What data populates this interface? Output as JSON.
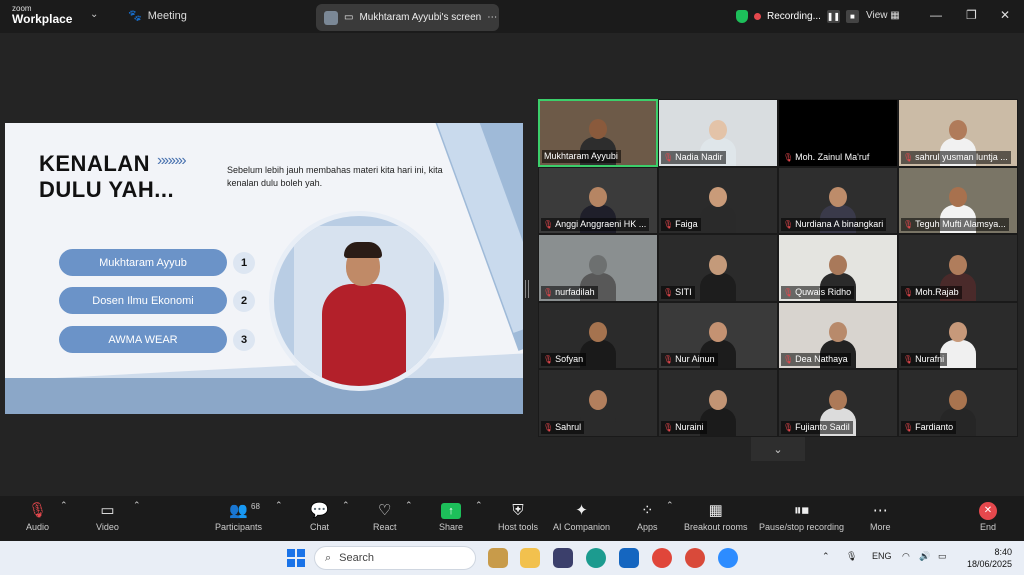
{
  "titlebar": {
    "brand_line1": "zoom",
    "brand_line2": "Workplace",
    "meeting_label": "Meeting",
    "screen_tab_label": "Mukhtaram Ayyubi's screen",
    "recording_label": "Recording...",
    "view_label": "View",
    "accent_green": "#1dbf5a",
    "record_red": "#e5484d"
  },
  "slide": {
    "title_line1": "KENALAN",
    "title_line2": "DULU YAH...",
    "arrows": "»»»»",
    "intro_text": "Sebelum lebih jauh membahas materi kita hari ini, kita kenalan dulu boleh yah.",
    "items": [
      {
        "label": "Mukhtaram Ayyub",
        "num": "1"
      },
      {
        "label": "Dosen Ilmu Ekonomi",
        "num": "2"
      },
      {
        "label": "AWMA WEAR",
        "num": "3"
      }
    ]
  },
  "gallery": [
    {
      "name": "Mukhtaram Ayyubi",
      "muted": false,
      "active": true,
      "bg": "#6d5a48",
      "skin": "#8a5a3c",
      "shirt": "#2d2d2d"
    },
    {
      "name": "Nadia Nadir",
      "muted": true,
      "bg": "#d9dde0",
      "skin": "#e3c3a8",
      "shirt": "#dfe6ea"
    },
    {
      "name": "Moh. Zainul Ma'ruf",
      "muted": true,
      "bg": "#000000",
      "skin": "#000000",
      "shirt": "#000000"
    },
    {
      "name": "sahrul yusman luntja ...",
      "muted": true,
      "bg": "#cbbba6",
      "skin": "#b07b5a",
      "shirt": "#f1f1f1"
    },
    {
      "name": "Anggi Anggraeni HK ...",
      "muted": true,
      "bg": "#3b3b3b",
      "skin": "#b68563",
      "shirt": "#1f1f2a"
    },
    {
      "name": "Faiga",
      "muted": true,
      "bg": "#2b2b2b",
      "skin": "#c99b79",
      "shirt": "#2a2a2a"
    },
    {
      "name": "Nurdiana A binangkari",
      "muted": true,
      "bg": "#2e2e2e",
      "skin": "#bd8c6a",
      "shirt": "#3a3a4a"
    },
    {
      "name": "Teguh Mufti Alamsya...",
      "muted": true,
      "bg": "#7a7566",
      "skin": "#a8714e",
      "shirt": "#f3f3f3"
    },
    {
      "name": "nurfadilah",
      "muted": true,
      "bg": "#8a8f90",
      "skin": "#6d7070",
      "shirt": "#585858"
    },
    {
      "name": "SITI",
      "muted": true,
      "bg": "#2b2b2b",
      "skin": "#c49a7a",
      "shirt": "#1d1d1d"
    },
    {
      "name": "Quwais Ridho",
      "muted": true,
      "bg": "#e4e4e0",
      "skin": "#a9795a",
      "shirt": "#2a2a2a"
    },
    {
      "name": "Moh.Rajab",
      "muted": true,
      "bg": "#2b2b2b",
      "skin": "#b07d5c",
      "shirt": "#4a2a2a"
    },
    {
      "name": "Sofyan",
      "muted": true,
      "bg": "#2b2b2b",
      "skin": "#a5734f",
      "shirt": "#1a1a1a"
    },
    {
      "name": "Nur Ainun",
      "muted": true,
      "bg": "#3a3a3a",
      "skin": "#c49272",
      "shirt": "#1c1c1c"
    },
    {
      "name": "Dea Nathaya",
      "muted": true,
      "bg": "#d8d4cf",
      "skin": "#b88a6b",
      "shirt": "#222222"
    },
    {
      "name": "Nurafni",
      "muted": true,
      "bg": "#2b2b2b",
      "skin": "#c7997a",
      "shirt": "#f0f0f0"
    },
    {
      "name": "Sahrul",
      "muted": true,
      "bg": "#2b2b2b",
      "skin": "#b27f5d",
      "shirt": "#2b2b2b"
    },
    {
      "name": "Nuraini",
      "muted": true,
      "bg": "#2b2b2b",
      "skin": "#c29474",
      "shirt": "#1b1b1b"
    },
    {
      "name": "Fujianto Sadil",
      "muted": true,
      "bg": "#2b2b2b",
      "skin": "#ad7a58",
      "shirt": "#dcdcdc"
    },
    {
      "name": "Fardianto",
      "muted": true,
      "bg": "#2b2b2b",
      "skin": "#a9744f",
      "shirt": "#262626"
    }
  ],
  "toolbar": {
    "audio": "Audio",
    "video": "Video",
    "participants": "Participants",
    "participants_count": "68",
    "chat": "Chat",
    "react": "React",
    "share": "Share",
    "host_tools": "Host tools",
    "ai_companion": "AI Companion",
    "apps": "Apps",
    "breakout_rooms": "Breakout rooms",
    "pause_stop_recording": "Pause/stop recording",
    "more": "More",
    "end": "End"
  },
  "taskbar": {
    "search_placeholder": "Search",
    "lang": "ENG",
    "time": "8:40",
    "date": "18/06/2025"
  }
}
